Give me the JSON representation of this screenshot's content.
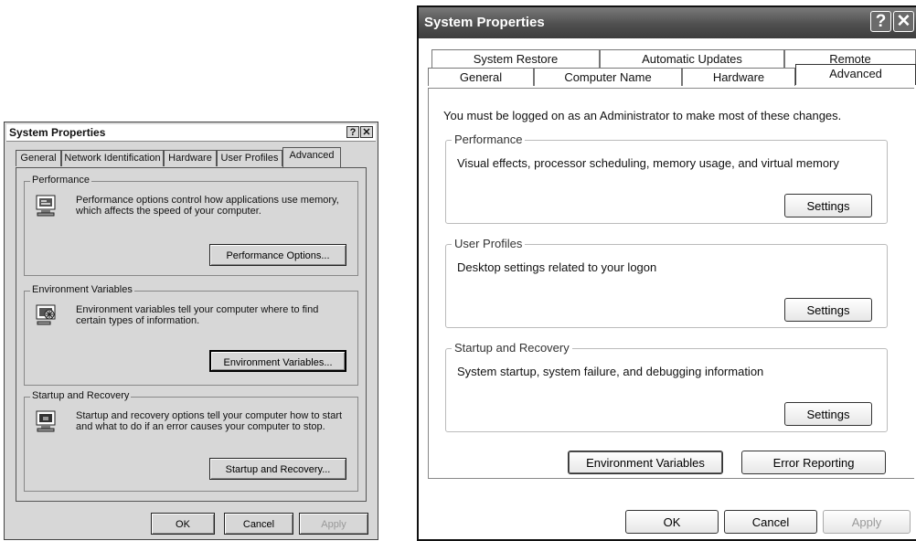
{
  "left_dialog": {
    "title": "System Properties",
    "help_btn": "?",
    "close_btn": "✕",
    "tabs": [
      "General",
      "Network Identification",
      "Hardware",
      "User Profiles",
      "Advanced"
    ],
    "active_tab": "Advanced",
    "groups": [
      {
        "label": "Performance",
        "desc": "Performance options control how applications use memory, which affects the speed of your computer.",
        "button": "Performance Options..."
      },
      {
        "label": "Environment Variables",
        "desc": "Environment variables tell your computer where to find certain types of information.",
        "button": "Environment Variables..."
      },
      {
        "label": "Startup and Recovery",
        "desc": "Startup and recovery options tell your computer how to start and what to do if an error causes your computer to stop.",
        "button": "Startup and Recovery..."
      }
    ],
    "footer": {
      "ok": "OK",
      "cancel": "Cancel",
      "apply": "Apply"
    }
  },
  "right_dialog": {
    "title": "System Properties",
    "help_btn": "?",
    "close_btn": "✕",
    "tabs_back": [
      "System Restore",
      "Automatic Updates",
      "Remote"
    ],
    "tabs_front": [
      "General",
      "Computer Name",
      "Hardware",
      "Advanced"
    ],
    "active_tab": "Advanced",
    "notice": "You must be logged on as an Administrator to make most of these changes.",
    "groups": [
      {
        "label": "Performance",
        "desc": "Visual effects, processor scheduling, memory usage, and virtual memory",
        "button": "Settings"
      },
      {
        "label": "User Profiles",
        "desc": "Desktop settings related to your logon",
        "button": "Settings"
      },
      {
        "label": "Startup and Recovery",
        "desc": "System startup, system failure, and debugging information",
        "button": "Settings"
      }
    ],
    "env_button": "Environment Variables",
    "error_button": "Error Reporting",
    "footer": {
      "ok": "OK",
      "cancel": "Cancel",
      "apply": "Apply"
    }
  }
}
